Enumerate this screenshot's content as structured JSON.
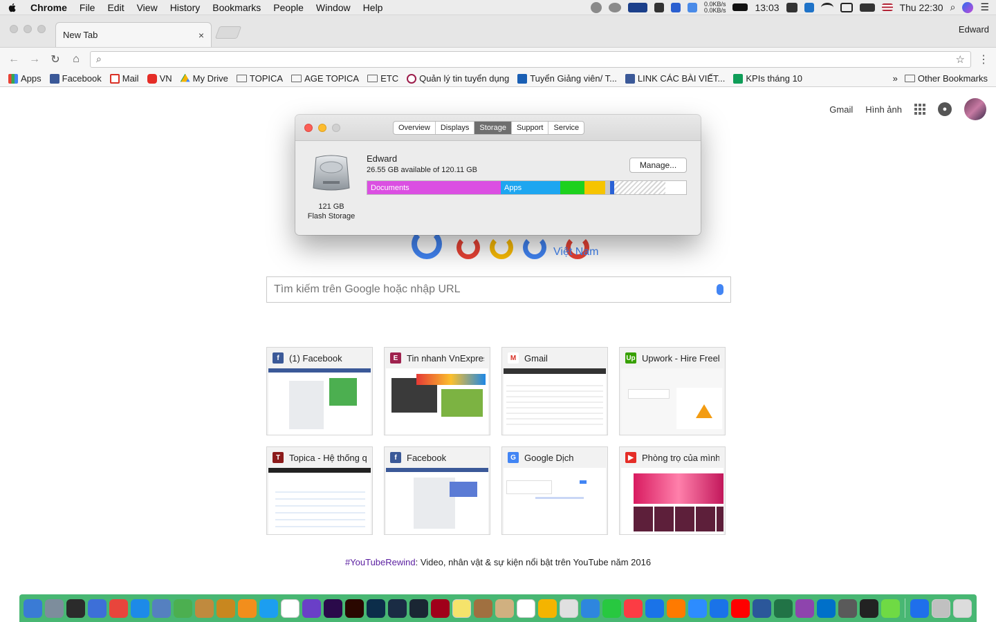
{
  "menubar": {
    "app": "Chrome",
    "menus": [
      "File",
      "Edit",
      "View",
      "History",
      "Bookmarks",
      "People",
      "Window",
      "Help"
    ],
    "net_up": "0.0KB/s",
    "net_down": "0.0KB/s",
    "clock_short": "13:03",
    "clock": "Thu 22:30"
  },
  "browser": {
    "tab_title": "New Tab",
    "tab_close": "×",
    "profile_name": "Edward",
    "omnibox_value": "",
    "bookmarks": [
      {
        "label": "Apps",
        "icon": "apps-grid-icon"
      },
      {
        "label": "Facebook",
        "icon": "facebook-icon"
      },
      {
        "label": "Mail",
        "icon": "gmail-icon"
      },
      {
        "label": "VN",
        "icon": "youtube-icon"
      },
      {
        "label": "My Drive",
        "icon": "drive-icon"
      },
      {
        "label": "TOPICA",
        "icon": "folder-icon"
      },
      {
        "label": "AGE TOPICA",
        "icon": "folder-icon"
      },
      {
        "label": "ETC",
        "icon": "folder-icon"
      },
      {
        "label": "Quản lý tin tuyển dụng",
        "icon": "site-icon"
      },
      {
        "label": "Tuyển Giảng viên/ T...",
        "icon": "w-icon"
      },
      {
        "label": "LINK CÁC BÀI VIẾT...",
        "icon": "facebook-icon"
      },
      {
        "label": "KPIs tháng 10",
        "icon": "sheets-icon"
      }
    ],
    "bookmarks_overflow": "»",
    "other_bookmarks": "Other Bookmarks"
  },
  "google": {
    "links": [
      "Gmail",
      "Hình ảnh"
    ],
    "region": "Việt Nam",
    "search_placeholder": "Tìm kiếm trên Google hoặc nhập URL",
    "tiles": [
      {
        "title": "(1) Facebook",
        "icon_color": "#3b5998",
        "icon_text": "f"
      },
      {
        "title": "Tin nhanh VnExpress",
        "icon_color": "#9f224e",
        "icon_text": "E"
      },
      {
        "title": "Gmail",
        "icon_color": "#ffffff",
        "icon_text": "M"
      },
      {
        "title": "Upwork - Hire Freelan",
        "icon_color": "#37a000",
        "icon_text": "Up"
      },
      {
        "title": "Topica - Hệ thống quả",
        "icon_color": "#8b1a1a",
        "icon_text": "T"
      },
      {
        "title": "Facebook",
        "icon_color": "#3b5998",
        "icon_text": "f"
      },
      {
        "title": "Google Dịch",
        "icon_color": "#4285f4",
        "icon_text": "G"
      },
      {
        "title": "Phòng trọ của mình v",
        "icon_color": "#e52d27",
        "icon_text": "▶"
      }
    ],
    "promo_tag": "#YouTubeRewind",
    "promo_text": ": Video, nhân vật & sự kiện nổi bật trên YouTube năm 2016"
  },
  "about_mac": {
    "tabs": [
      "Overview",
      "Displays",
      "Storage",
      "Support",
      "Service"
    ],
    "selected_tab": "Storage",
    "volume_name": "Edward",
    "available": "26.55 GB available of 120.11 GB",
    "manage_label": "Manage...",
    "disk_size": "121 GB",
    "disk_type": "Flash Storage",
    "segments": [
      {
        "label": "Documents",
        "fraction": 0.418,
        "color": "#db4fe2"
      },
      {
        "label": "Apps",
        "fraction": 0.186,
        "color": "#1ea6f0"
      },
      {
        "label": "",
        "fraction": 0.076,
        "color": "#1ed11e"
      },
      {
        "label": "",
        "fraction": 0.064,
        "color": "#f6c400"
      },
      {
        "label": "",
        "fraction": 0.016,
        "color": "#c9c9c9"
      },
      {
        "label": "",
        "fraction": 0.012,
        "color": "#2a62d6"
      }
    ],
    "purgeable_fraction": 0.16
  },
  "dock": {
    "colors": [
      "#3a7bd5",
      "#7d8d9c",
      "#2b2b2b",
      "#3d6fd8",
      "#e8453c",
      "#1d8ae8",
      "#5580c0",
      "#4caf50",
      "#c08a3e",
      "#c8871f",
      "#f28e1c",
      "#1c9ef0",
      "#ffffff",
      "#6a3fc7",
      "#2a0a4a",
      "#2a0800",
      "#0c2d4a",
      "#1a2c44",
      "#1a2633",
      "#a0001a",
      "#f5e36b",
      "#a07040",
      "#d0b080",
      "#ffffff",
      "#f4b400",
      "#e0e0e0",
      "#2e86de",
      "#28c840",
      "#fc3c44",
      "#1a73e8",
      "#ff7a00",
      "#2d8cff",
      "#1a73e8",
      "#ff0000",
      "#2b579a",
      "#217346",
      "#8e44ad",
      "#0070c9",
      "#5a5a5a",
      "#222222",
      "#6fda44",
      "#1f6feb",
      "#c0c0c0",
      "#dcdcdc"
    ]
  }
}
